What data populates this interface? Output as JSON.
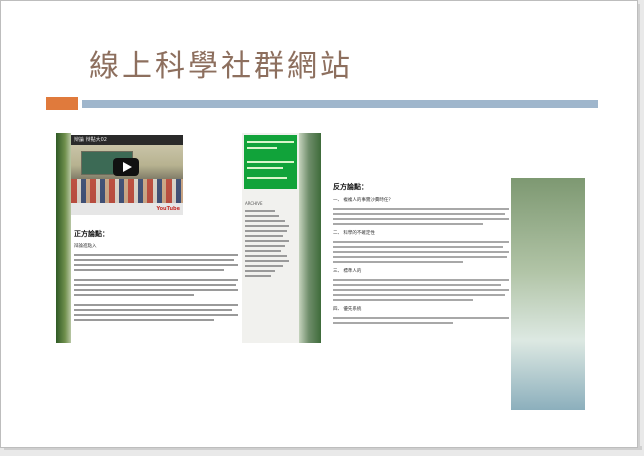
{
  "slide": {
    "title": "線上科學社群網站",
    "accent_colors": {
      "orange": "#e07a3c",
      "blue": "#9fb6cc",
      "title": "#8d6f5e"
    }
  },
  "left_screenshot": {
    "video_title": "辩論 辩點大02",
    "video_logo": "YouTube",
    "section_heading": "正方論點：",
    "subheading": "辩論進點入",
    "archive_label": "ARCHIVE"
  },
  "right_screenshot": {
    "section_heading": "反方論點：",
    "points": [
      "一、 複複人的事實沙費時任？",
      "二、 科學的不確定性",
      "三、 標準人的",
      "四、 優先系統"
    ]
  }
}
